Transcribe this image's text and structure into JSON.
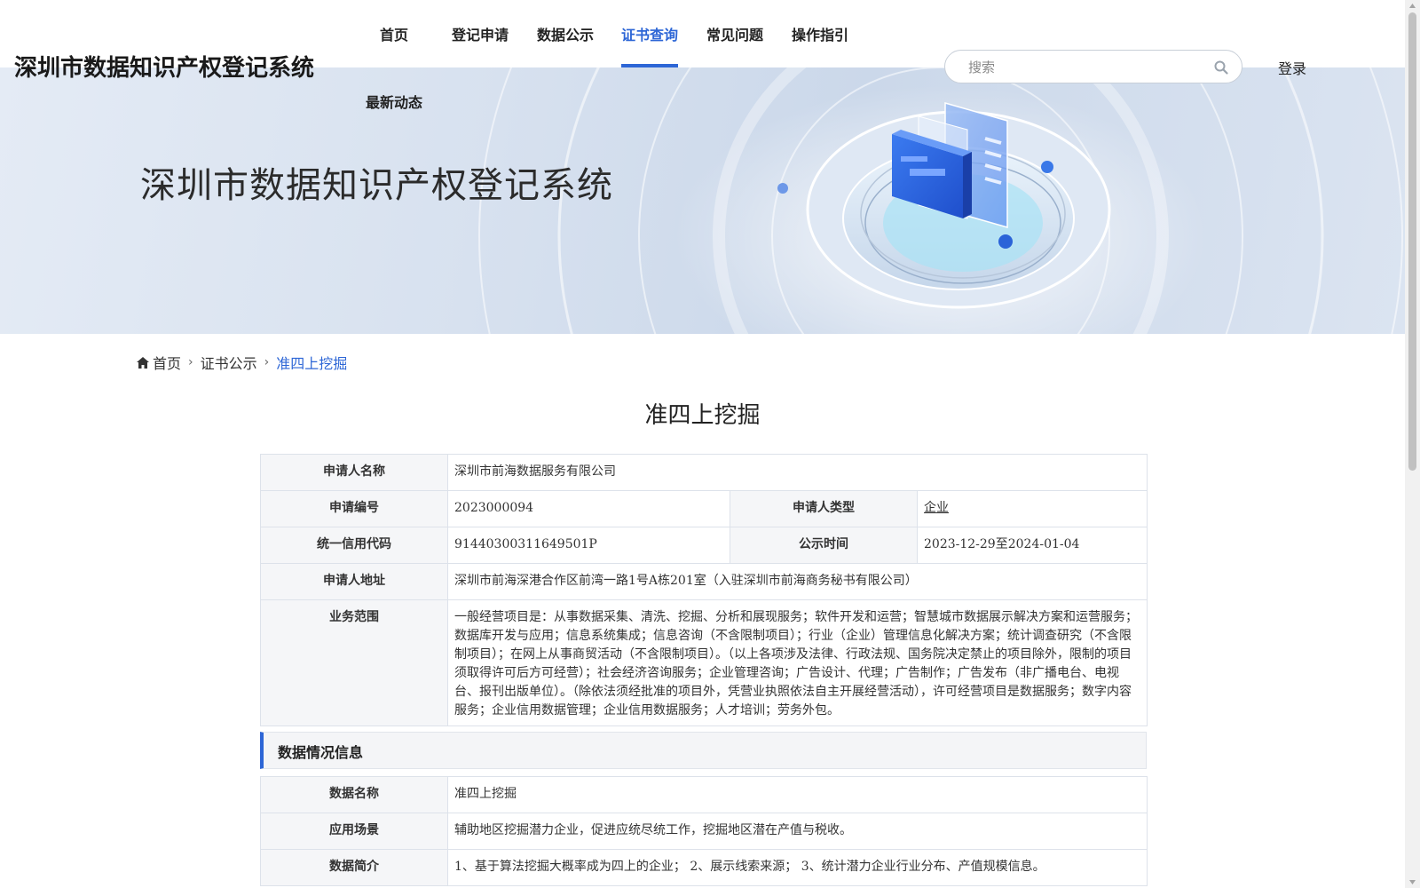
{
  "header": {
    "site_title": "深圳市数据知识产权登记系统",
    "nav": [
      {
        "label": "首页"
      },
      {
        "label": "登记申请"
      },
      {
        "label": "数据公示"
      },
      {
        "label": "证书查询"
      },
      {
        "label": "常见问题"
      },
      {
        "label": "操作指引"
      },
      {
        "label": "最新动态"
      }
    ],
    "active_nav": "证书查询",
    "search_placeholder": "搜索",
    "login_label": "登录"
  },
  "banner": {
    "title": "深圳市数据知识产权登记系统"
  },
  "breadcrumb": {
    "home": "首页",
    "parent": "证书公示",
    "current": "准四上挖掘"
  },
  "page_title": "准四上挖掘",
  "applicant": {
    "name_label": "申请人名称",
    "name": "深圳市前海数据服务有限公司",
    "number_label": "申请编号",
    "number": "2023000094",
    "type_label": "申请人类型",
    "type": "企业",
    "credit_label": "统一信用代码",
    "credit": "91440300311649501P",
    "publicity_label": "公示时间",
    "publicity": "2023-12-29至2024-01-04",
    "address_label": "申请人地址",
    "address": "深圳市前海深港合作区前湾一路1号A栋201室（入驻深圳市前海商务秘书有限公司）",
    "scope_label": "业务范围",
    "scope": "一般经营项目是：从事数据采集、清洗、挖掘、分析和展现服务；软件开发和运营；智慧城市数据展示解决方案和运营服务；数据库开发与应用；信息系统集成；信息咨询（不含限制项目）；行业（企业）管理信息化解决方案；统计调查研究（不含限制项目）；在网上从事商贸活动（不含限制项目）。（以上各项涉及法律、行政法规、国务院决定禁止的项目除外，限制的项目须取得许可后方可经营）；社会经济咨询服务；企业管理咨询；广告设计、代理；广告制作；广告发布（非广播电台、电视台、报刊出版单位）。（除依法须经批准的项目外，凭营业执照依法自主开展经营活动），许可经营项目是数据服务；数字内容服务；企业信用数据管理；企业信用数据服务；人才培训；劳务外包。"
  },
  "data_section": {
    "title": "数据情况信息",
    "data_name_label": "数据名称",
    "data_name": "准四上挖掘",
    "scenario_label": "应用场景",
    "scenario": "辅助地区挖掘潜力企业，促进应统尽统工作，挖掘地区潜在产值与税收。",
    "intro_label": "数据简介",
    "intro": "1、基于算法挖掘大概率成为四上的企业； 2、展示线索来源； 3、统计潜力企业行业分布、产值规模信息。"
  },
  "colors": {
    "accent": "#2d66d6",
    "label_bg": "#f5f6f8",
    "border": "#dde2ea"
  }
}
